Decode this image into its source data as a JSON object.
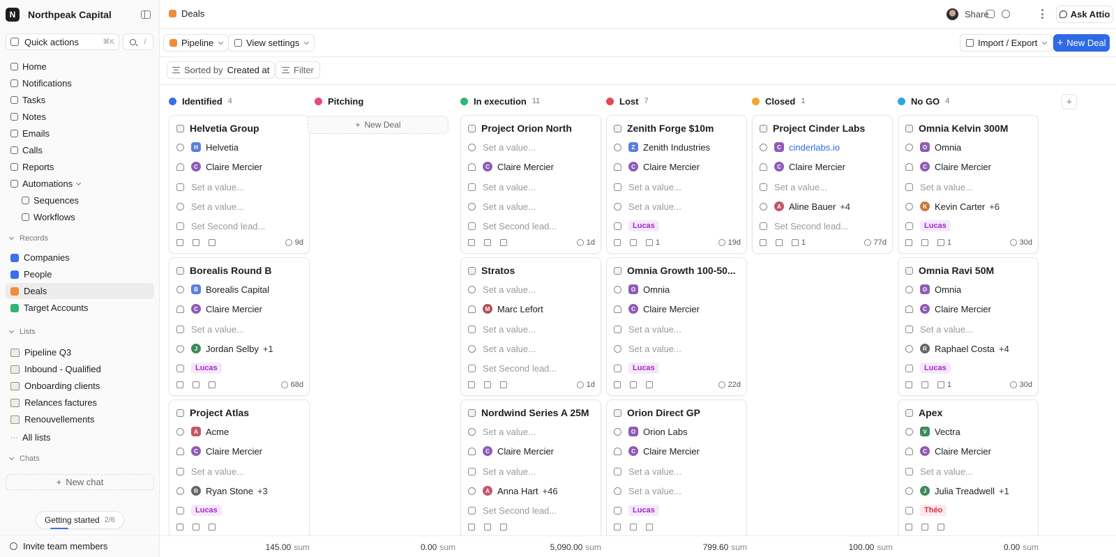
{
  "workspace": {
    "initial": "N",
    "name": "Northpeak Capital"
  },
  "sidebar": {
    "quick_actions": "Quick actions",
    "quick_actions_kbd": "⌘K",
    "search_kbd": "/",
    "nav": [
      {
        "label": "Home",
        "icon": "home-icon"
      },
      {
        "label": "Notifications",
        "icon": "bell-icon"
      },
      {
        "label": "Tasks",
        "icon": "checkbox-icon"
      },
      {
        "label": "Notes",
        "icon": "note-icon"
      },
      {
        "label": "Emails",
        "icon": "mail-icon"
      },
      {
        "label": "Calls",
        "icon": "phone-icon"
      },
      {
        "label": "Reports",
        "icon": "chart-icon"
      },
      {
        "label": "Automations",
        "icon": "bolt-icon"
      }
    ],
    "automations_children": [
      "Sequences",
      "Workflows"
    ],
    "records_label": "Records",
    "records": [
      {
        "label": "Companies",
        "color": "#3a6fe8"
      },
      {
        "label": "People",
        "color": "#3a6fe8"
      },
      {
        "label": "Deals",
        "color": "#f08c3b"
      },
      {
        "label": "Target Accounts",
        "color": "#2fb574"
      }
    ],
    "lists_label": "Lists",
    "lists": [
      "Pipeline Q3",
      "Inbound - Qualified",
      "Onboarding clients",
      "Relances factures",
      "Renouvellements"
    ],
    "all_lists": "All lists",
    "chats_label": "Chats",
    "new_chat": "New chat",
    "getting_started": "Getting started",
    "getting_started_progress": "2/6",
    "invite": "Invite team members"
  },
  "topbar": {
    "title": "Deals",
    "share": "Share",
    "ask": "Ask Attio"
  },
  "toolbar": {
    "view": "Pipeline",
    "view_settings": "View settings",
    "import_export": "Import / Export",
    "new_deal": "New Deal"
  },
  "filterbar": {
    "sorted_by": "Sorted by",
    "sort_field": "Created at",
    "filter": "Filter"
  },
  "board": {
    "new_deal": "New Deal",
    "columns": [
      {
        "name": "Identified",
        "count": "4",
        "color": "#3a6fe8",
        "sum": "145.00",
        "sum_unit": "sum",
        "cards": [
          {
            "title": "Helvetia Group",
            "company": {
              "text": "Helvetia",
              "initial": "H",
              "color": "#5b7fdb"
            },
            "owner": {
              "text": "Claire Mercier",
              "initial": "C",
              "color": "#8e5bb5"
            },
            "r3": "Set a value...",
            "r4": {
              "placeholder": "Set a value..."
            },
            "r5": {
              "placeholder": "Set Second lead..."
            },
            "footer": {
              "age": "9d"
            }
          },
          {
            "title": "Borealis Round B",
            "company": {
              "text": "Borealis Capital",
              "initial": "B",
              "color": "#5b7fdb"
            },
            "owner": {
              "text": "Claire Mercier",
              "initial": "C",
              "color": "#8e5bb5"
            },
            "r3": "Set a value...",
            "r4": {
              "text": "Jordan Selby",
              "initial": "J",
              "color": "#3d8a5a",
              "more": "+1"
            },
            "r5": {
              "tag": "Lucas"
            },
            "footer": {
              "age": "68d"
            }
          },
          {
            "title": "Project Atlas",
            "company": {
              "text": "Acme",
              "initial": "A",
              "color": "#c4566a"
            },
            "owner": {
              "text": "Claire Mercier",
              "initial": "C",
              "color": "#8e5bb5"
            },
            "r3": "Set a value...",
            "r4": {
              "text": "Ryan Stone",
              "initial": "R",
              "color": "#666",
              "more": "+3"
            },
            "r5": {
              "tag": "Lucas"
            },
            "footer": {
              "age": ""
            }
          }
        ]
      },
      {
        "name": "Pitching",
        "count": "",
        "color": "#e8487a",
        "sum": "0.00",
        "sum_unit": "sum",
        "cards": []
      },
      {
        "name": "In execution",
        "count": "11",
        "color": "#2fb574",
        "sum": "5,090.00",
        "sum_unit": "sum",
        "cards": [
          {
            "title": "Project Orion North",
            "company": {
              "placeholder": "Set a value..."
            },
            "owner": {
              "text": "Claire Mercier",
              "initial": "C",
              "color": "#8e5bb5"
            },
            "r3": "Set a value...",
            "r4": {
              "placeholder": "Set a value..."
            },
            "r5": {
              "placeholder": "Set Second lead..."
            },
            "footer": {
              "age": "1d"
            }
          },
          {
            "title": "Stratos",
            "company": {
              "placeholder": "Set a value..."
            },
            "owner": {
              "text": "Marc Lefort",
              "initial": "M",
              "color": "#b0505a"
            },
            "r3": "Set a value...",
            "r4": {
              "placeholder": "Set a value..."
            },
            "r5": {
              "placeholder": "Set Second lead..."
            },
            "footer": {
              "age": "1d"
            }
          },
          {
            "title": "Nordwind Series A 25M",
            "company": {
              "placeholder": "Set a value..."
            },
            "owner": {
              "text": "Claire Mercier",
              "initial": "C",
              "color": "#8e5bb5"
            },
            "r3": "Set a value...",
            "r4": {
              "text": "Anna Hart",
              "initial": "A",
              "color": "#c4566a",
              "more": "+46"
            },
            "r5": {
              "placeholder": "Set Second lead..."
            },
            "footer": {
              "age": ""
            }
          }
        ]
      },
      {
        "name": "Lost",
        "count": "7",
        "color": "#e5484d",
        "sum": "799.60",
        "sum_unit": "sum",
        "cards": [
          {
            "title": "Zenith Forge $10m",
            "company": {
              "text": "Zenith Industries",
              "initial": "Z",
              "color": "#5b7fdb"
            },
            "owner": {
              "text": "Claire Mercier",
              "initial": "C",
              "color": "#8e5bb5"
            },
            "r3": "Set a value...",
            "r4": {
              "placeholder": "Set a value..."
            },
            "r5": {
              "tag": "Lucas"
            },
            "footer": {
              "comments": "1",
              "age": "19d"
            }
          },
          {
            "title": "Omnia Growth 100-50...",
            "company": {
              "text": "Omnia",
              "initial": "O",
              "color": "#8e5bb5"
            },
            "owner": {
              "text": "Claire Mercier",
              "initial": "C",
              "color": "#8e5bb5"
            },
            "r3": "Set a value...",
            "r4": {
              "placeholder": "Set a value..."
            },
            "r5": {
              "tag": "Lucas"
            },
            "footer": {
              "age": "22d"
            }
          },
          {
            "title": "Orion Direct GP",
            "company": {
              "text": "Orion Labs",
              "initial": "O",
              "color": "#8e5bb5"
            },
            "owner": {
              "text": "Claire Mercier",
              "initial": "C",
              "color": "#8e5bb5"
            },
            "r3": "Set a value...",
            "r4": {
              "placeholder": "Set a value..."
            },
            "r5": {
              "tag": "Lucas"
            },
            "footer": {
              "age": ""
            }
          }
        ]
      },
      {
        "name": "Closed",
        "count": "1",
        "color": "#f0a62b",
        "sum": "100.00",
        "sum_unit": "sum",
        "cards": [
          {
            "title": "Project Cinder Labs",
            "company": {
              "text": "cinderlabs.io",
              "initial": "C",
              "color": "#8e5bb5",
              "link": true
            },
            "owner": {
              "text": "Claire Mercier",
              "initial": "C",
              "color": "#8e5bb5"
            },
            "r3": "Set a value...",
            "r4": {
              "text": "Aline Bauer",
              "initial": "A",
              "color": "#c4566a",
              "more": "+4"
            },
            "r5": {
              "placeholder": "Set Second lead..."
            },
            "footer": {
              "comments": "1",
              "age": "77d"
            }
          }
        ]
      },
      {
        "name": "No GO",
        "count": "4",
        "color": "#2ea8e0",
        "sum": "0.00",
        "sum_unit": "sum",
        "cards": [
          {
            "title": "Omnia Kelvin 300M",
            "company": {
              "text": "Omnia",
              "initial": "O",
              "color": "#8e5bb5"
            },
            "owner": {
              "text": "Claire Mercier",
              "initial": "C",
              "color": "#8e5bb5"
            },
            "r3": "Set a value...",
            "r4": {
              "text": "Kevin Carter",
              "initial": "K",
              "color": "#c87a3a",
              "more": "+6"
            },
            "r5": {
              "tag": "Lucas"
            },
            "footer": {
              "comments": "1",
              "age": "30d"
            }
          },
          {
            "title": "Omnia Ravi 50M",
            "company": {
              "text": "Omnia",
              "initial": "O",
              "color": "#8e5bb5"
            },
            "owner": {
              "text": "Claire Mercier",
              "initial": "C",
              "color": "#8e5bb5"
            },
            "r3": "Set a value...",
            "r4": {
              "text": "Raphael Costa",
              "initial": "R",
              "color": "#666",
              "more": "+4"
            },
            "r5": {
              "tag": "Lucas"
            },
            "footer": {
              "comments": "1",
              "age": "30d"
            }
          },
          {
            "title": "Apex",
            "company": {
              "text": "Vectra",
              "initial": "V",
              "color": "#3d8a5a"
            },
            "owner": {
              "text": "Claire Mercier",
              "initial": "C",
              "color": "#8e5bb5"
            },
            "r3": "Set a value...",
            "r4": {
              "text": "Julia Treadwell",
              "initial": "J",
              "color": "#3d8a5a",
              "more": "+1"
            },
            "r5": {
              "tag": "Théo",
              "tag_style": "theo"
            },
            "footer": {
              "age": ""
            }
          }
        ]
      }
    ]
  }
}
